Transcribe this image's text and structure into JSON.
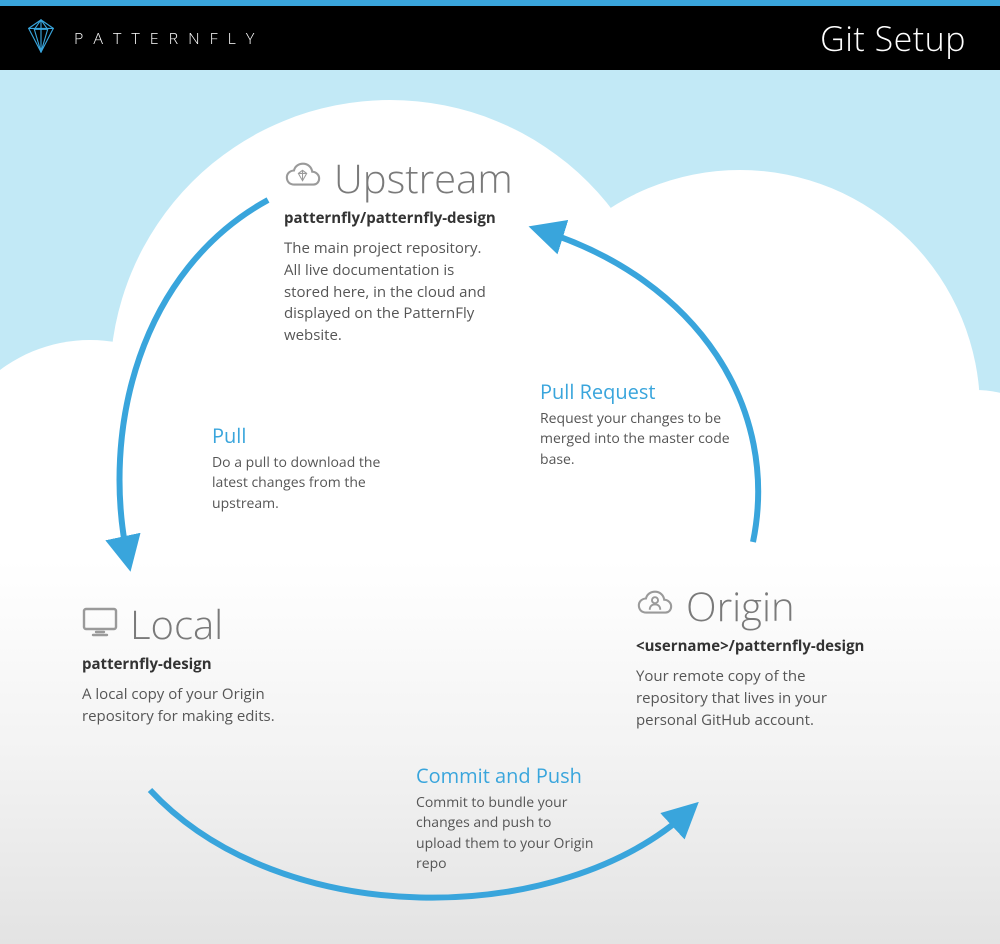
{
  "header": {
    "brand": "PATTERNFLY",
    "title": "Git Setup"
  },
  "nodes": {
    "upstream": {
      "title": "Upstream",
      "path": "patternfly/patternfly-design",
      "desc": "The main project repository. All live documentation is stored here, in the cloud and displayed on the PatternFly website."
    },
    "local": {
      "title": "Local",
      "path": "patternfly-design",
      "desc": "A local copy of your Origin repository for making edits."
    },
    "origin": {
      "title": "Origin",
      "path": "<username>/patternfly-design",
      "desc": "Your remote copy of the repository that lives in your personal GitHub account."
    }
  },
  "arrows": {
    "pull": {
      "title": "Pull",
      "desc": "Do a pull to download the latest changes from the upstream."
    },
    "pull_request": {
      "title": "Pull Request",
      "desc": "Request your changes to be merged into the master code base."
    },
    "commit_push": {
      "title": "Commit and Push",
      "desc": "Commit to bundle your changes and push to upload them to your Origin repo"
    }
  },
  "colors": {
    "accent": "#39a5dc",
    "sky": "#c2e9f6",
    "heading_gray": "#7a7a7a",
    "icon_gray": "#9a9a9a"
  }
}
